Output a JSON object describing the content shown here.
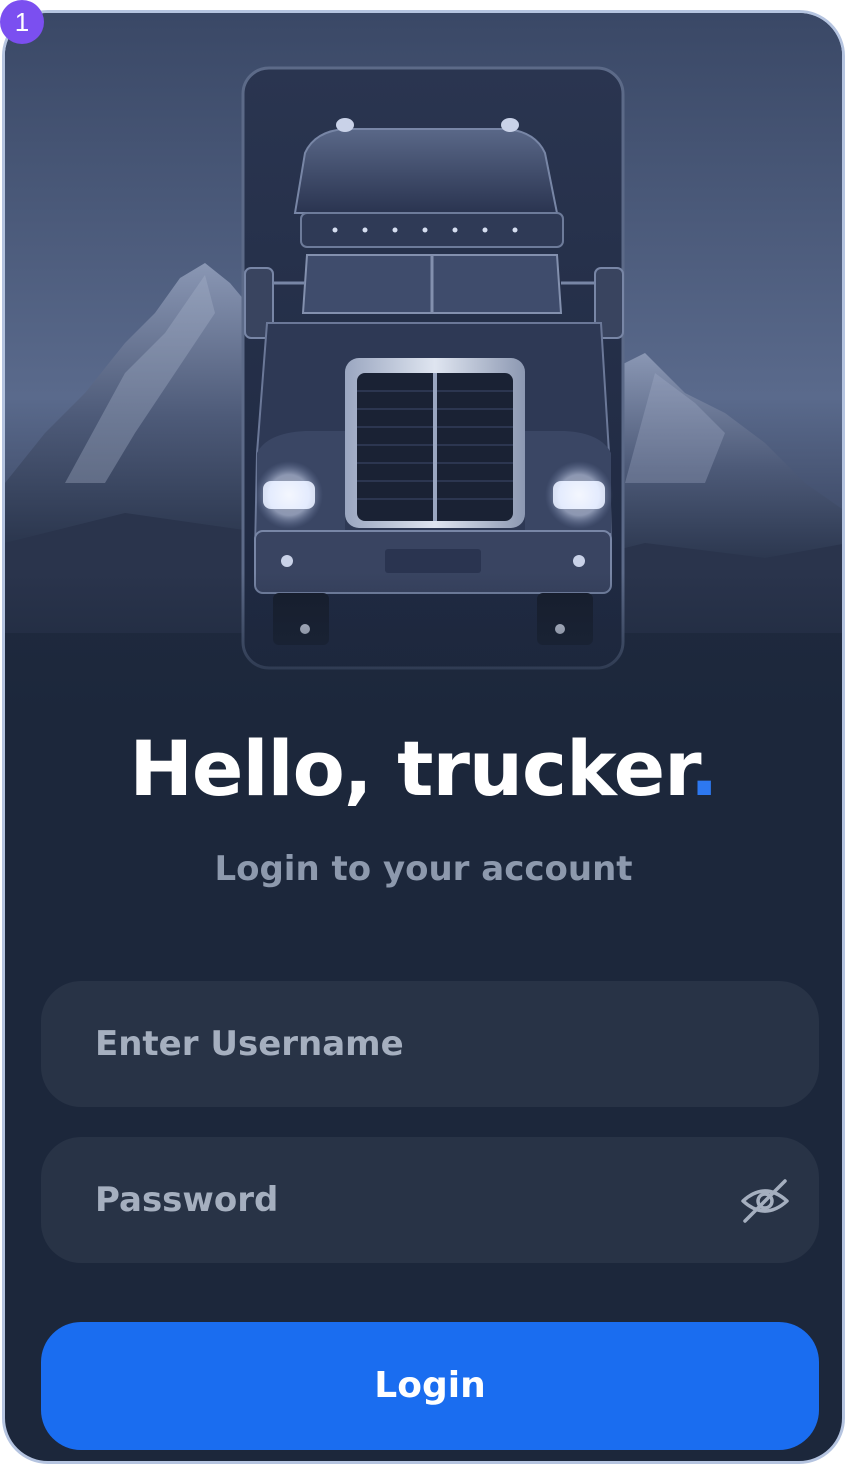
{
  "badge": {
    "number": "1"
  },
  "hero": {
    "illustration": "truck-mountains-night"
  },
  "header": {
    "greeting": "Hello, trucker",
    "greeting_dot": ".",
    "subtitle": "Login to your account"
  },
  "form": {
    "username_placeholder": "Enter Username",
    "password_placeholder": "Password",
    "password_toggle_icon": "eye-off-icon",
    "login_label": "Login"
  },
  "colors": {
    "background": "#1c273b",
    "field": "#283346",
    "accent": "#1a6df0",
    "border": "#b5c4e0",
    "badge": "#7b4ff0"
  }
}
